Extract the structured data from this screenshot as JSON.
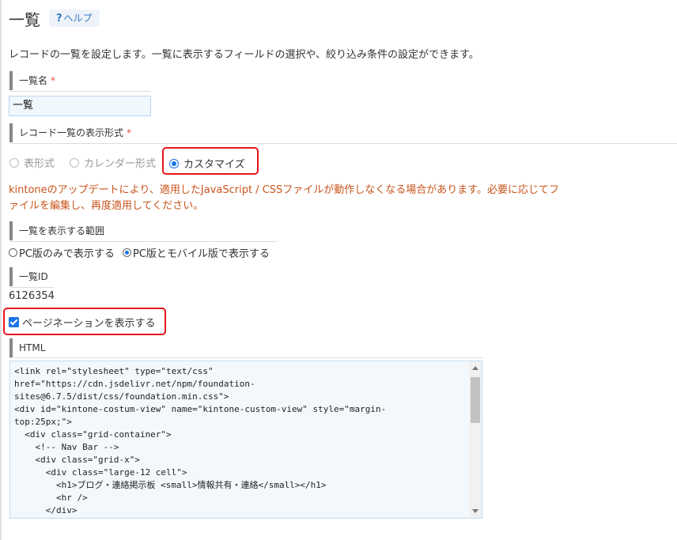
{
  "page": {
    "title": "一覧",
    "help_label": "ヘルプ",
    "help_icon": "question-mark-icon",
    "description": "レコードの一覧を設定します。一覧に表示するフィールドの選択や、絞り込み条件の設定ができます。"
  },
  "view_name": {
    "label": "一覧名",
    "required_mark": "*",
    "value": "一覧"
  },
  "display_format": {
    "label": "レコード一覧の表示形式",
    "required_mark": "*",
    "options": [
      {
        "label": "表形式",
        "selected": false,
        "disabled": true
      },
      {
        "label": "カレンダー形式",
        "selected": false,
        "disabled": true
      },
      {
        "label": "カスタマイズ",
        "selected": true,
        "disabled": false
      }
    ],
    "warning": "kintoneのアップデートにより、適用したJavaScript / CSSファイルが動作しなくなる場合があります。必要に応じてファイルを編集し、再度適用してください。"
  },
  "display_scope": {
    "label": "一覧を表示する範囲",
    "options": [
      {
        "label": "PC版のみで表示する",
        "selected": false
      },
      {
        "label": "PC版とモバイル版で表示する",
        "selected": true
      }
    ]
  },
  "view_id": {
    "label": "一覧ID",
    "value": "6126354"
  },
  "pagination": {
    "label": "ページネーションを表示する",
    "checked": true
  },
  "html": {
    "label": "HTML",
    "code": "<link rel=\"stylesheet\" type=\"text/css\"\nhref=\"https://cdn.jsdelivr.net/npm/foundation-\nsites@6.7.5/dist/css/foundation.min.css\">\n<div id=\"kintone-costum-view\" name=\"kintone-custom-view\" style=\"margin-\ntop:25px;\">\n  <div class=\"grid-container\">\n    <!-- Nav Bar -->\n    <div class=\"grid-x\">\n      <div class=\"large-12 cell\">\n        <h1>ブログ・連絡掲示板 <small>情報共有・連絡</small></h1>\n        <hr />\n      </div>\n    </div>\n    <!-- End Nav -->"
  },
  "colors": {
    "accent": "#1a73e8",
    "warning": "#c8541b",
    "highlight": "#e8141d",
    "required": "#e74c3c"
  }
}
